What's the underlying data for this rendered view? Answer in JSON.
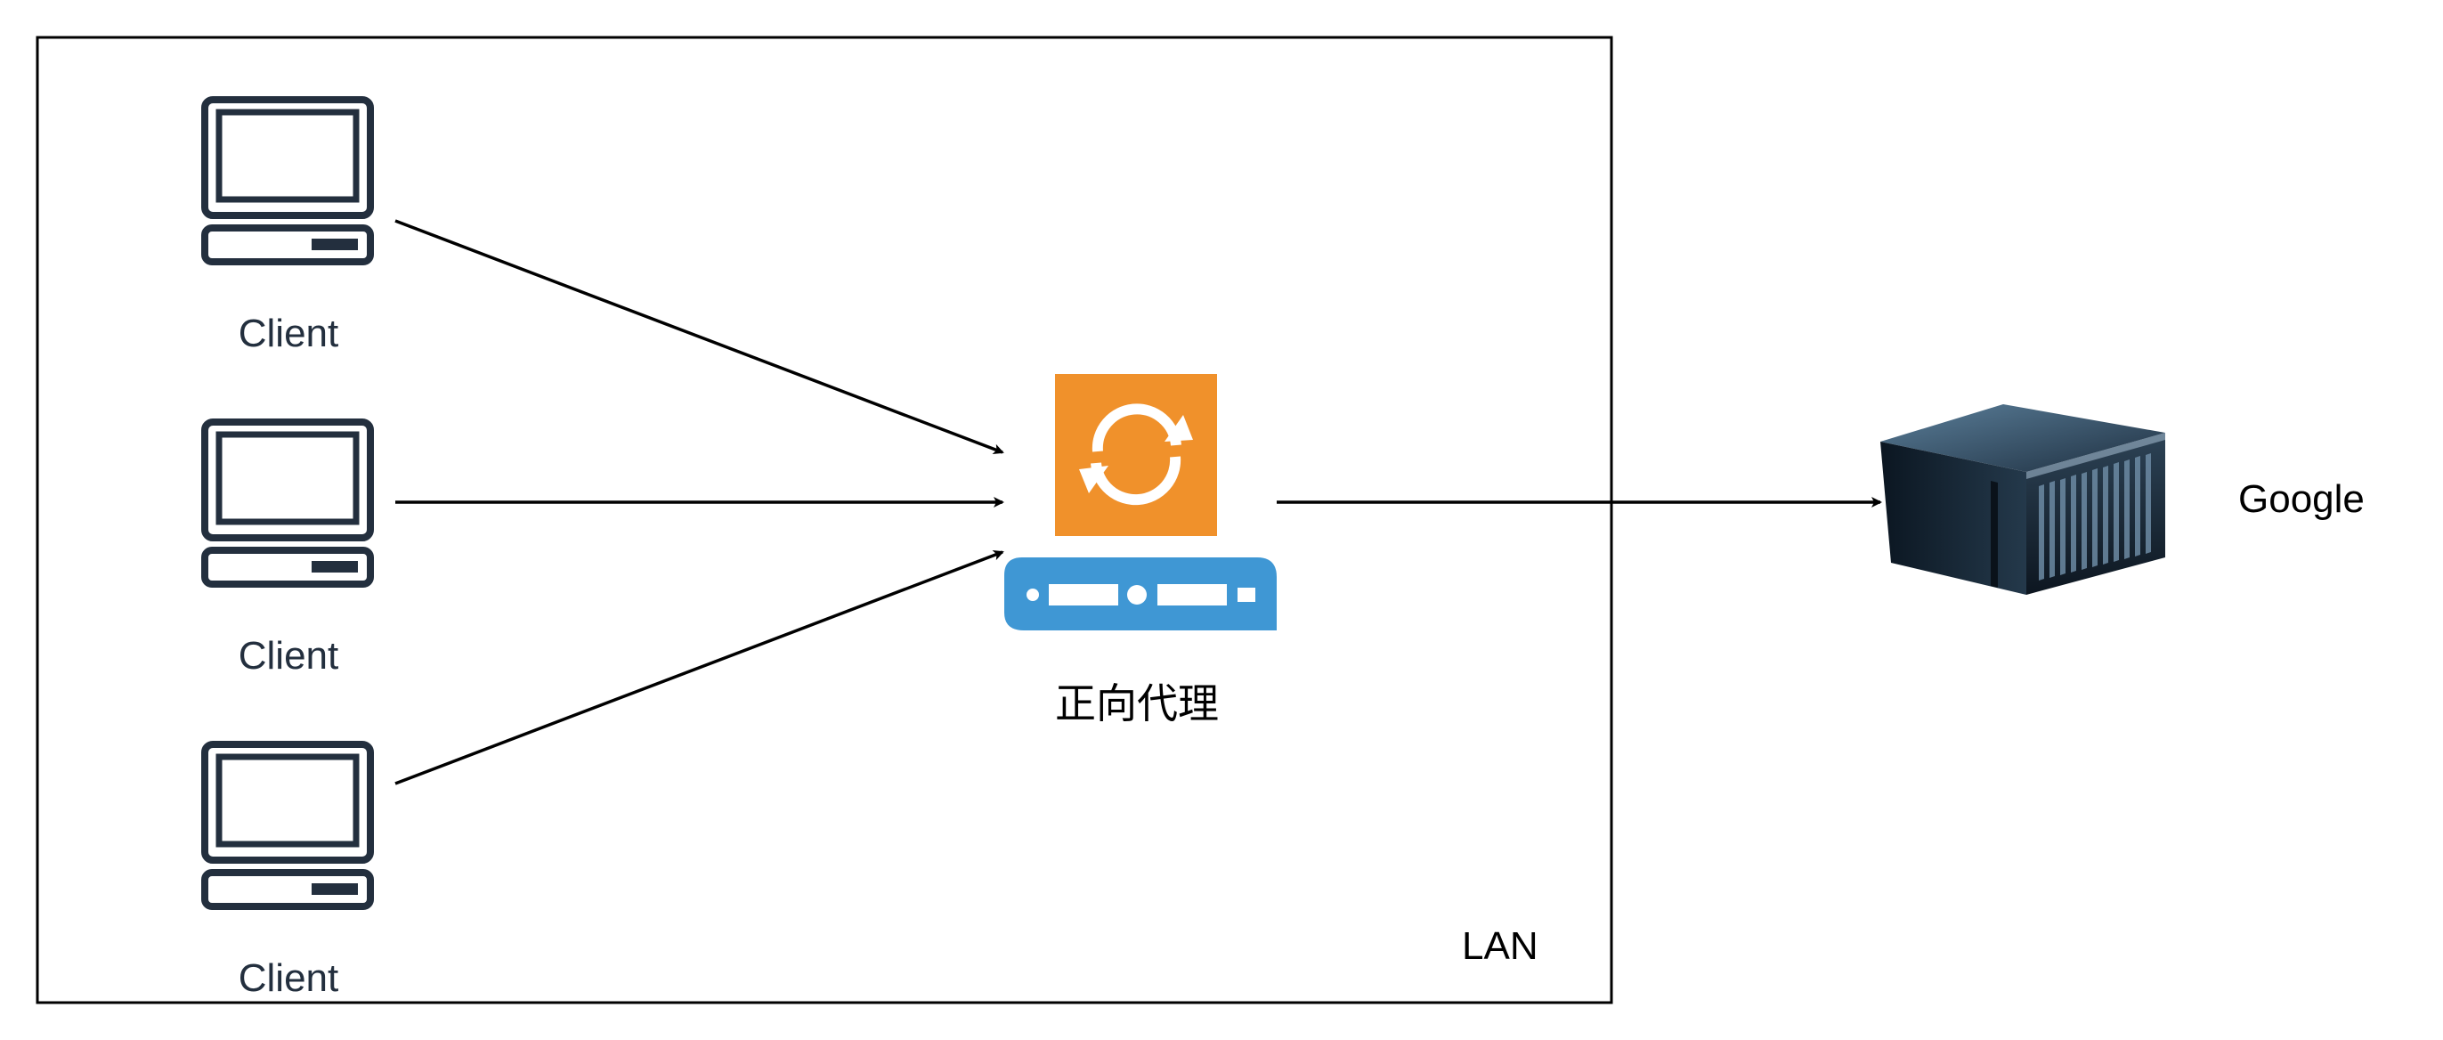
{
  "diagram": {
    "boundary": {
      "label": "LAN"
    },
    "clients": [
      {
        "label": "Client",
        "icon": "client-computer-icon"
      },
      {
        "label": "Client",
        "icon": "client-computer-icon"
      },
      {
        "label": "Client",
        "icon": "client-computer-icon"
      }
    ],
    "proxy": {
      "label": "正向代理",
      "icon": "sync-proxy-icon",
      "icon_color": "#f0912b",
      "device_color": "#3f97d4"
    },
    "server": {
      "label": "Google",
      "icon": "server-rack-icon"
    },
    "colors": {
      "client_icon": "#232f3e",
      "lines": "#000000"
    }
  }
}
